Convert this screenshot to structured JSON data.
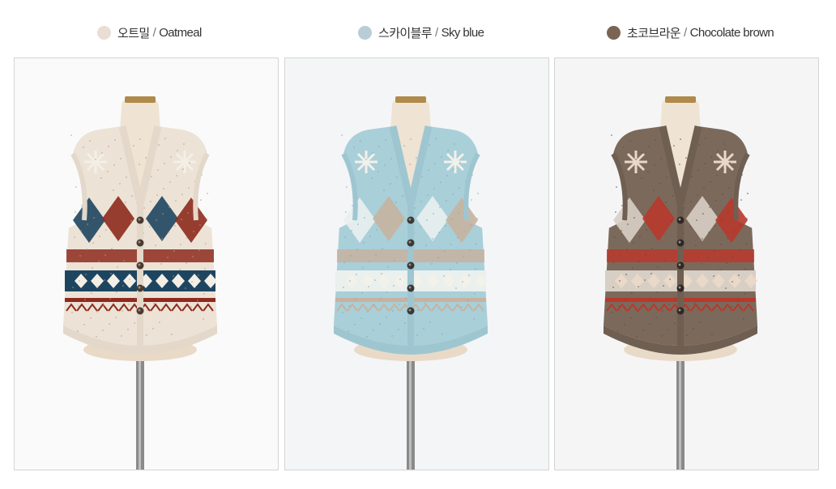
{
  "colors": [
    {
      "id": "oatmeal",
      "korean": "오트밀",
      "separator": "/",
      "english": "Oatmeal",
      "swatch": "#e8ded3",
      "knit": "#ece3d6",
      "rib": "#e3d8c9",
      "accent1": "#8e2a1e",
      "accent2": "#1e4560",
      "accent3": "#f4efe6",
      "speck": "#b69a84",
      "button": "#4a3a30",
      "bg": "#fafafa"
    },
    {
      "id": "sky-blue",
      "korean": "스카이블루",
      "separator": "/",
      "english": "Sky blue",
      "swatch": "#b9cdd6",
      "knit": "#a9cfd9",
      "rib": "#9ec6d1",
      "accent1": "#c7b29f",
      "accent2": "#e9f0ee",
      "accent3": "#f2f1ea",
      "speck": "#7fa9b5",
      "button": "#3a3836",
      "bg": "#f4f5f6"
    },
    {
      "id": "chocolate-brown",
      "korean": "초코브라운",
      "separator": "/",
      "english": "Chocolate brown",
      "swatch": "#7a6555",
      "knit": "#7b6a5c",
      "rib": "#6f5f52",
      "accent1": "#b8382c",
      "accent2": "#d8cfc4",
      "accent3": "#ead9c8",
      "speck": "#5b4c41",
      "button": "#2e2724",
      "bg": "#f5f5f6"
    }
  ]
}
